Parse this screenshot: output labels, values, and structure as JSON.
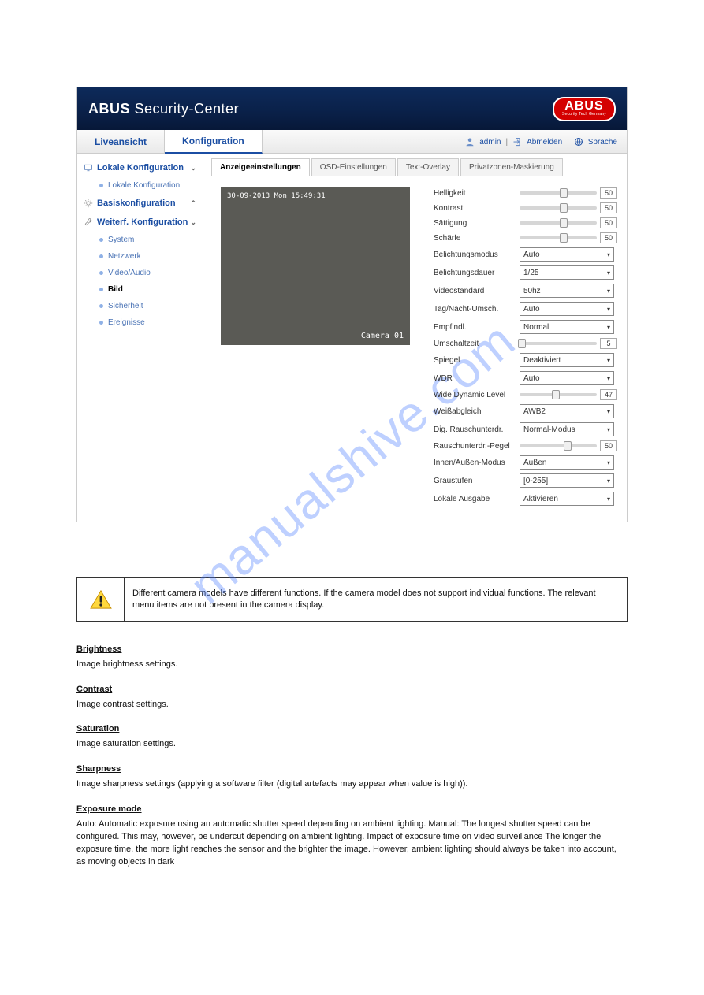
{
  "watermark": "manualshive.com",
  "header": {
    "title_strong": "ABUS",
    "title_rest": " Security-Center",
    "logo_text": "ABUS",
    "logo_tag": "Security Tech Germany"
  },
  "tabs": {
    "live": "Liveansicht",
    "config": "Konfiguration"
  },
  "userbar": {
    "user": "admin",
    "logout": "Abmelden",
    "lang": "Sprache",
    "sep": "|"
  },
  "sidebar": {
    "local": "Lokale Konfiguration",
    "local_sub": "Lokale Konfiguration",
    "basic": "Basiskonfiguration",
    "adv": "Weiterf. Konfiguration",
    "items": [
      {
        "label": "System"
      },
      {
        "label": "Netzwerk"
      },
      {
        "label": "Video/Audio"
      },
      {
        "label": "Bild"
      },
      {
        "label": "Sicherheit"
      },
      {
        "label": "Ereignisse"
      }
    ]
  },
  "ctabs": {
    "t0": "Anzeigeeinstellungen",
    "t1": "OSD-Einstellungen",
    "t2": "Text-Overlay",
    "t3": "Privatzonen-Maskierung"
  },
  "preview": {
    "timestamp": "30-09-2013 Mon 15:49:31",
    "camera": "Camera 01"
  },
  "settings": {
    "brightness": {
      "label": "Helligkeit",
      "value": "50",
      "pos": 57
    },
    "contrast": {
      "label": "Kontrast",
      "value": "50",
      "pos": 57
    },
    "saturation": {
      "label": "Sättigung",
      "value": "50",
      "pos": 57
    },
    "sharpness": {
      "label": "Schärfe",
      "value": "50",
      "pos": 57
    },
    "exposure_mode": {
      "label": "Belichtungsmodus",
      "value": "Auto"
    },
    "exposure_time": {
      "label": "Belichtungsdauer",
      "value": "1/25"
    },
    "videostandard": {
      "label": "Videostandard",
      "value": "50hz"
    },
    "daynight": {
      "label": "Tag/Nacht-Umsch.",
      "value": "Auto"
    },
    "sensitivity": {
      "label": "Empfindl.",
      "value": "Normal"
    },
    "switchtime": {
      "label": "Umschaltzeit",
      "value": "5",
      "pos": 3
    },
    "mirror": {
      "label": "Spiegel",
      "value": "Deaktiviert"
    },
    "wdr": {
      "label": "WDR",
      "value": "Auto"
    },
    "wdl": {
      "label": "Wide Dynamic Level",
      "value": "47",
      "pos": 47
    },
    "whitebalance": {
      "label": "Weißabgleich",
      "value": "AWB2"
    },
    "dnr": {
      "label": "Dig. Rauschunterdr.",
      "value": "Normal-Modus"
    },
    "dnr_level": {
      "label": "Rauschunterdr.-Pegel",
      "value": "50",
      "pos": 62
    },
    "inout": {
      "label": "Innen/Außen-Modus",
      "value": "Außen"
    },
    "greyscale": {
      "label": "Graustufen",
      "value": "[0-255]"
    },
    "localout": {
      "label": "Lokale Ausgabe",
      "value": "Aktivieren"
    }
  },
  "note": "Different camera models have different functions. If the camera model does not support individual functions. The relevant menu items are not present in the camera display.",
  "doc": {
    "brightness_h": "Brightness",
    "brightness_b": "Image brightness settings.",
    "contrast_h": "Contrast",
    "contrast_b": "Image contrast settings.",
    "saturation_h": "Saturation",
    "saturation_b": "Image saturation settings.",
    "sharpness_h": "Sharpness",
    "sharpness_b": "Image sharpness settings (applying a software filter (digital artefacts may appear when value is high)).",
    "exposure_h": "Exposure mode",
    "exposure_b": "Auto: Automatic exposure using an automatic shutter speed depending on ambient lighting. Manual: The longest shutter speed can be configured. This may, however, be undercut depending on ambient lighting. Impact of exposure time on video surveillance The longer the exposure time, the more light reaches the sensor and the brighter the image. However, ambient lighting should always be taken into account, as moving objects in dark"
  }
}
